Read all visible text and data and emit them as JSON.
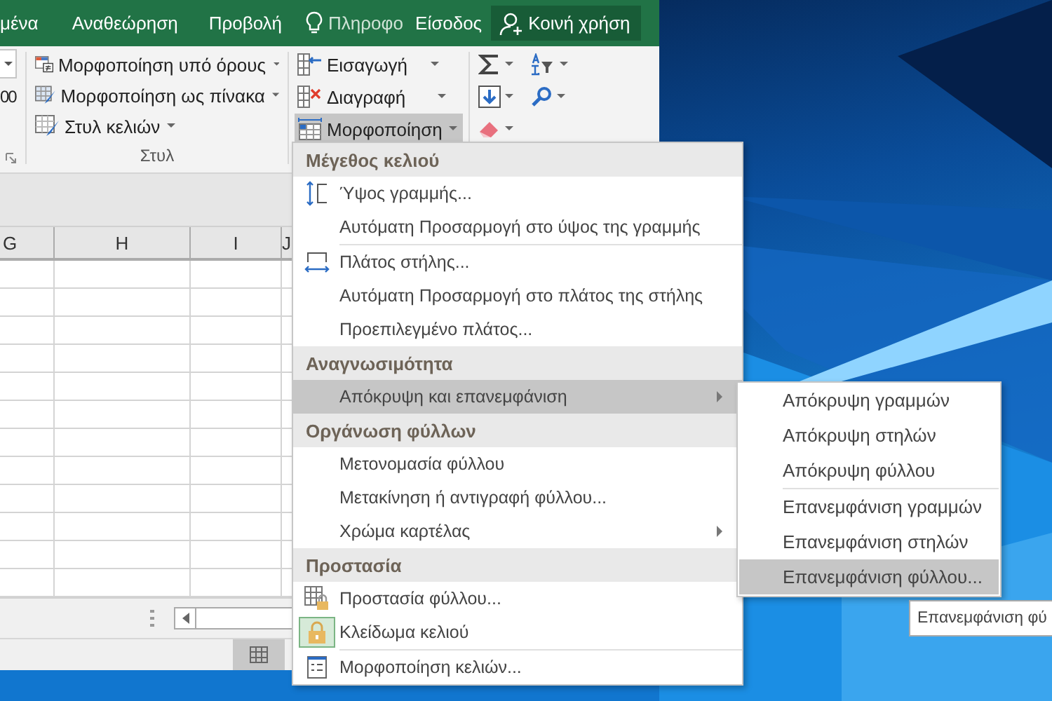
{
  "ribbon_tabs": [
    {
      "label": "μένα"
    },
    {
      "label": "Αναθεώρηση"
    },
    {
      "label": "Προβολή"
    }
  ],
  "tell_me": {
    "placeholder": "Πληροφο"
  },
  "sign_in": "Είσοδος",
  "share": "Κοινή χρήση",
  "ribbon": {
    "partial_group": {
      "value": "00"
    },
    "styles_group": {
      "label": "Στυλ",
      "buttons": [
        {
          "label": "Μορφοποίηση υπό όρους"
        },
        {
          "label": "Μορφοποίηση ως πίνακα"
        },
        {
          "label": "Στυλ κελιών"
        }
      ]
    },
    "cells_group": {
      "buttons": [
        {
          "label": "Εισαγωγή",
          "pressed": false
        },
        {
          "label": "Διαγραφή",
          "pressed": false
        },
        {
          "label": "Μορφοποίηση",
          "pressed": true
        }
      ]
    }
  },
  "sheet": {
    "columns": [
      "G",
      "H",
      "I",
      "J"
    ]
  },
  "menu": {
    "sections": [
      {
        "title": "Μέγεθος κελιού",
        "groups": [
          [
            {
              "label": "Ύψος γραμμής...",
              "kind": "rowheight",
              "submenu": false,
              "selected": false,
              "checked": false
            },
            {
              "label": "Αυτόματη Προσαρμογή στο ύψος της γραμμής",
              "kind": "plain",
              "submenu": false,
              "selected": false,
              "checked": false
            }
          ],
          [
            {
              "label": "Πλάτος στήλης...",
              "kind": "colwidth",
              "submenu": false,
              "selected": false,
              "checked": false
            },
            {
              "label": "Αυτόματη Προσαρμογή στο πλάτος της στήλης",
              "kind": "plain",
              "submenu": false,
              "selected": false,
              "checked": false
            },
            {
              "label": "Προεπιλεγμένο πλάτος...",
              "kind": "plain",
              "submenu": false,
              "selected": false,
              "checked": false
            }
          ]
        ]
      },
      {
        "title": "Αναγνωσιμότητα",
        "groups": [
          [
            {
              "label": "Απόκρυψη και επανεμφάνιση",
              "kind": "plain",
              "submenu": true,
              "selected": true,
              "checked": false
            }
          ]
        ]
      },
      {
        "title": "Οργάνωση φύλλων",
        "groups": [
          [
            {
              "label": "Μετονομασία φύλλου",
              "kind": "plain",
              "submenu": false,
              "selected": false,
              "checked": false
            },
            {
              "label": "Μετακίνηση ή αντιγραφή φύλλου...",
              "kind": "plain",
              "submenu": false,
              "selected": false,
              "checked": false
            },
            {
              "label": "Χρώμα καρτέλας",
              "kind": "plain",
              "submenu": true,
              "selected": false,
              "checked": false
            }
          ]
        ]
      },
      {
        "title": "Προστασία",
        "groups": [
          [
            {
              "label": "Προστασία φύλλου...",
              "kind": "sheetlock",
              "submenu": false,
              "selected": false,
              "checked": false
            },
            {
              "label": "Κλείδωμα κελιού",
              "kind": "lock",
              "submenu": false,
              "selected": false,
              "checked": true
            }
          ],
          [
            {
              "label": "Μορφοποίηση κελιών...",
              "kind": "dialog",
              "submenu": false,
              "selected": false,
              "checked": false
            }
          ]
        ]
      }
    ]
  },
  "submenu": {
    "groups": [
      [
        {
          "label": "Απόκρυψη γραμμών",
          "selected": false
        },
        {
          "label": "Απόκρυψη στηλών",
          "selected": false
        },
        {
          "label": "Απόκρυψη φύλλου",
          "selected": false
        }
      ],
      [
        {
          "label": "Επανεμφάνιση γραμμών",
          "selected": false
        },
        {
          "label": "Επανεμφάνιση στηλών",
          "selected": false
        },
        {
          "label": "Επανεμφάνιση φύλλου...",
          "selected": true
        }
      ]
    ]
  },
  "tooltip": "Επανεμφάνιση φύ"
}
